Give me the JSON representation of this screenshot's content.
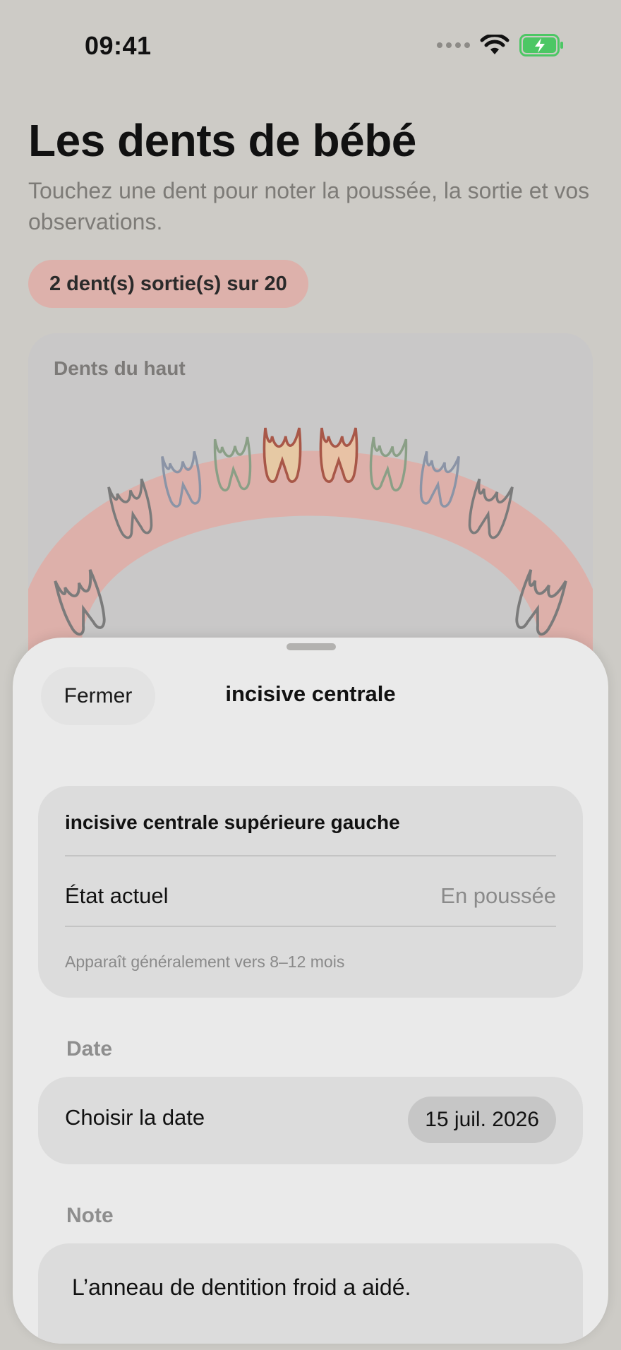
{
  "status_bar": {
    "time": "09:41"
  },
  "page": {
    "title": "Les dents de bébé",
    "subtitle": "Touchez une dent pour noter la poussée, la sortie et vos observations.",
    "count_badge": "2 dent(s) sortie(s) sur 20"
  },
  "upper_arch": {
    "title": "Dents du haut"
  },
  "sheet": {
    "close_label": "Fermer",
    "title": "incisive centrale",
    "tooth_full_name": "incisive centrale supérieure gauche",
    "state_label": "État actuel",
    "state_value": "En poussée",
    "eruption_hint": "Apparaît généralement vers 8–12 mois",
    "date_section": "Date",
    "date_label": "Choisir la date",
    "date_value": "15 juil. 2026",
    "note_section": "Note",
    "note_text": "L’anneau de dentition froid a aidé."
  },
  "colors": {
    "gum": "#e2aca5",
    "tooth_erupting_fill": "#e6c9a4",
    "tooth_erupting_stroke": "#a85748",
    "tooth_erupted_stroke": "#a85748",
    "tooth_green": "#8a9f86",
    "tooth_blue": "#8b94a6",
    "tooth_gray": "#7b7b7b",
    "battery": "#4cc764"
  },
  "icons": {
    "wifi": "wifi-icon",
    "battery": "battery-charging-icon",
    "signal": "cellular-signal-icon"
  }
}
